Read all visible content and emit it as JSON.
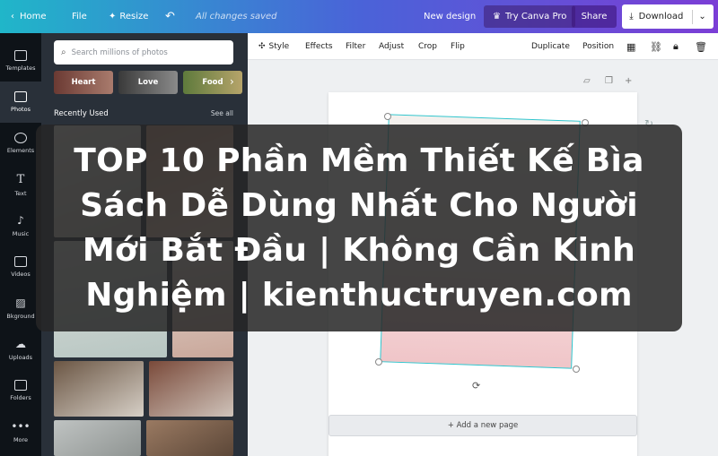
{
  "topbar": {
    "home": "Home",
    "file": "File",
    "resize": "Resize",
    "saved": "All changes saved",
    "new_design": "New design",
    "try_pro": "Try Canva Pro",
    "share": "Share",
    "download": "Download",
    "colors": {
      "gradient_start": "#20b6c9",
      "gradient_mid": "#4a63d8",
      "gradient_end": "#7b3ed6"
    }
  },
  "rail": {
    "items": [
      {
        "label": "Templates",
        "icon": "templates-icon"
      },
      {
        "label": "Photos",
        "icon": "photos-icon"
      },
      {
        "label": "Elements",
        "icon": "elements-icon"
      },
      {
        "label": "Text",
        "icon": "text-icon"
      },
      {
        "label": "Music",
        "icon": "music-icon"
      },
      {
        "label": "Videos",
        "icon": "videos-icon"
      },
      {
        "label": "Bkground",
        "icon": "background-icon"
      },
      {
        "label": "Uploads",
        "icon": "uploads-icon"
      },
      {
        "label": "Folders",
        "icon": "folders-icon"
      },
      {
        "label": "More",
        "icon": "more-icon"
      }
    ],
    "active": "Photos"
  },
  "panel": {
    "search_placeholder": "Search millions of photos",
    "chips": [
      "Heart",
      "Love",
      "Food"
    ],
    "section_title": "Recently Used",
    "see_all": "See all"
  },
  "toolbar": {
    "style": "Style",
    "effects": "Effects",
    "filter": "Filter",
    "adjust": "Adjust",
    "crop": "Crop",
    "flip": "Flip",
    "duplicate": "Duplicate",
    "position": "Position"
  },
  "canvas": {
    "add_page": "+ Add a new page"
  },
  "overlay": {
    "caption": "TOP 10 Phần Mềm Thiết Kế Bìa Sách Dễ Dùng Nhất Cho Người Mới Bắt Đầu | Không Cần Kinh Nghiệm | kienthuctruyen.com"
  }
}
